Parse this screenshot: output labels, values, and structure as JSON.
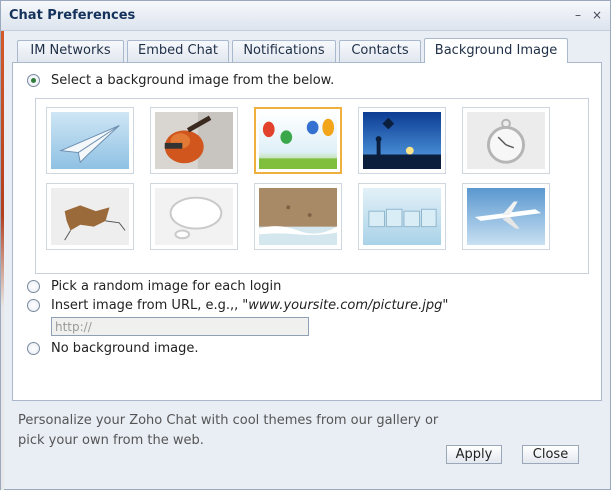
{
  "window": {
    "title": "Chat Preferences"
  },
  "titlebar": {
    "minimize_glyph": "–",
    "close_glyph": "×"
  },
  "tabs": [
    {
      "label": "IM Networks"
    },
    {
      "label": "Embed Chat"
    },
    {
      "label": "Notifications"
    },
    {
      "label": "Contacts"
    },
    {
      "label": "Background Image",
      "active": true
    }
  ],
  "options": {
    "gallery_label": "Select a background image from the below.",
    "random_label": "Pick a random image for each login",
    "url_label": "Insert image from URL, e.g.,,",
    "url_example": "\"www.yoursite.com/picture.jpg\"",
    "url_placeholder": "http://",
    "none_label": "No background image.",
    "selected": "gallery"
  },
  "gallery": {
    "selected_index": 2,
    "thumbnails": [
      {
        "icon": "paper-plane-icon"
      },
      {
        "icon": "guitar-icon"
      },
      {
        "icon": "hot-air-balloons-icon"
      },
      {
        "icon": "kite-silhouette-icon"
      },
      {
        "icon": "pocket-watch-icon"
      },
      {
        "icon": "cracked-wall-icon"
      },
      {
        "icon": "speech-bubble-icon"
      },
      {
        "icon": "sand-beach-icon"
      },
      {
        "icon": "ice-cubes-icon"
      },
      {
        "icon": "airplane-icon"
      }
    ]
  },
  "footer": {
    "text_line1": "Personalize your Zoho Chat with cool themes from our gallery or",
    "text_line2": "pick your own from the web.",
    "apply_label": "Apply",
    "close_label": "Close"
  },
  "colors": {
    "accent_selected_border": "#f0b040",
    "title_color": "#15325c",
    "radio_checked": "#2f7d3a"
  }
}
